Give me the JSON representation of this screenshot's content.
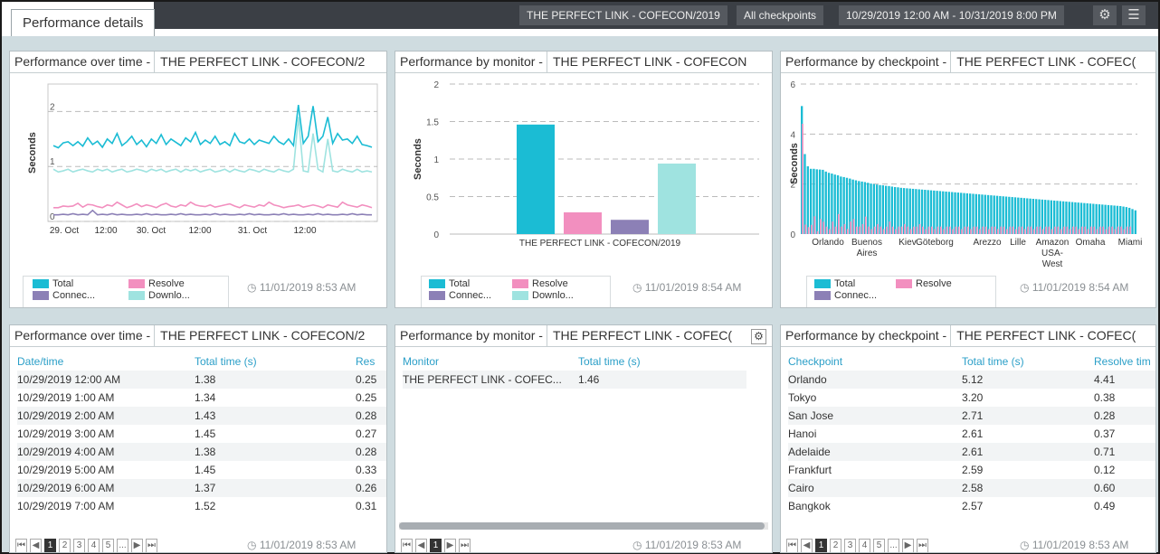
{
  "header": {
    "tab_label": "Performance details",
    "monitor": "THE PERFECT LINK - COFECON/2019",
    "checkpoints": "All checkpoints",
    "date_range": "10/29/2019 12:00 AM - 10/31/2019 8:00 PM",
    "gear_icon": "gear-icon",
    "menu_icon": "hamburger-menu-icon"
  },
  "colors": {
    "total": "#1bbcd4",
    "resolve": "#f28fbf",
    "connect": "#8c80b6",
    "download": "#9fe3e0"
  },
  "legend": {
    "total": "Total",
    "resolve": "Resolve",
    "connect": "Connec...",
    "download": "Downlo..."
  },
  "panels": {
    "p1": {
      "title": "Performance over time -",
      "selector": "THE PERFECT LINK - COFECON/2",
      "stamp": "11/01/2019 8:53 AM"
    },
    "p2": {
      "title": "Performance by monitor -",
      "selector": "THE PERFECT LINK - COFECON",
      "stamp": "11/01/2019 8:54 AM"
    },
    "p3": {
      "title": "Performance by checkpoint -",
      "selector": "THE PERFECT LINK - COFEC(",
      "stamp": "11/01/2019 8:54 AM"
    },
    "p4": {
      "title": "Performance over time -",
      "selector": "THE PERFECT LINK - COFECON/2",
      "stamp": "11/01/2019 8:53 AM"
    },
    "p5": {
      "title": "Performance by monitor -",
      "selector": "THE PERFECT LINK - COFEC(",
      "stamp": "11/01/2019 8:53 AM"
    },
    "p6": {
      "title": "Performance by checkpoint -",
      "selector": "THE PERFECT LINK - COFEC(",
      "stamp": "11/01/2019 8:53 AM"
    }
  },
  "chart_data": [
    {
      "type": "line",
      "ylabel": "Seconds",
      "ylim": [
        0,
        2.5
      ],
      "yticks": [
        "0",
        "1",
        "2"
      ],
      "xticks": [
        "29. Oct",
        "12:00",
        "30. Oct",
        "12:00",
        "31. Oct",
        "12:00"
      ],
      "series": [
        {
          "name": "Total",
          "values": [
            1.38,
            1.34,
            1.43,
            1.45,
            1.38,
            1.45,
            1.37,
            1.52,
            1.4,
            1.46,
            1.35,
            1.5,
            1.42,
            1.6,
            1.38,
            1.45,
            1.55,
            1.4,
            1.48,
            1.36,
            1.5,
            1.42,
            1.58,
            1.4,
            1.5,
            1.44,
            1.38,
            1.52,
            1.45,
            1.62,
            1.4,
            1.48,
            1.42,
            1.55,
            1.4,
            1.45,
            1.38,
            1.6,
            1.45,
            1.42,
            1.5,
            1.4,
            1.48,
            1.45,
            1.42,
            1.55,
            1.45,
            1.4,
            1.5,
            1.38,
            2.12,
            1.42,
            1.55,
            2.1,
            1.45,
            1.55,
            1.9,
            1.42,
            1.6,
            1.48,
            1.5,
            1.42,
            1.55,
            1.4,
            1.38,
            1.35
          ]
        },
        {
          "name": "Download",
          "values": [
            0.95,
            0.9,
            0.92,
            0.95,
            0.9,
            0.93,
            0.95,
            0.92,
            0.9,
            0.95,
            0.92,
            0.95,
            0.9,
            0.93,
            0.95,
            0.9,
            0.92,
            0.95,
            0.93,
            0.9,
            0.95,
            0.92,
            0.95,
            0.9,
            0.93,
            0.95,
            0.9,
            0.95,
            0.92,
            0.95,
            0.9,
            0.93,
            0.95,
            0.9,
            0.92,
            0.95,
            0.9,
            0.95,
            0.92,
            0.9,
            0.95,
            0.93,
            0.9,
            0.95,
            0.92,
            0.9,
            0.95,
            0.92,
            0.9,
            0.95,
            1.9,
            0.92,
            0.9,
            1.6,
            0.95,
            0.9,
            1.5,
            0.92,
            0.9,
            0.95,
            0.92,
            0.9,
            0.95,
            0.9,
            0.92,
            0.9
          ]
        },
        {
          "name": "Resolve",
          "values": [
            0.25,
            0.25,
            0.28,
            0.27,
            0.28,
            0.33,
            0.26,
            0.31,
            0.3,
            0.27,
            0.25,
            0.3,
            0.28,
            0.35,
            0.3,
            0.25,
            0.28,
            0.32,
            0.27,
            0.3,
            0.28,
            0.25,
            0.3,
            0.33,
            0.28,
            0.26,
            0.3,
            0.28,
            0.35,
            0.3,
            0.28,
            0.27,
            0.3,
            0.26,
            0.28,
            0.3,
            0.32,
            0.28,
            0.25,
            0.3,
            0.28,
            0.26,
            0.3,
            0.28,
            0.35,
            0.3,
            0.28,
            0.25,
            0.27,
            0.28,
            0.3,
            0.26,
            0.28,
            0.3,
            0.28,
            0.25,
            0.3,
            0.28,
            0.26,
            0.35,
            0.3,
            0.28,
            0.26,
            0.3,
            0.28,
            0.25
          ]
        },
        {
          "name": "Connect",
          "values": [
            0.12,
            0.12,
            0.13,
            0.12,
            0.14,
            0.12,
            0.13,
            0.12,
            0.2,
            0.12,
            0.13,
            0.12,
            0.14,
            0.12,
            0.13,
            0.12,
            0.12,
            0.13,
            0.12,
            0.14,
            0.12,
            0.13,
            0.12,
            0.12,
            0.13,
            0.12,
            0.14,
            0.12,
            0.13,
            0.12,
            0.12,
            0.13,
            0.12,
            0.14,
            0.12,
            0.13,
            0.12,
            0.12,
            0.13,
            0.12,
            0.14,
            0.12,
            0.13,
            0.12,
            0.12,
            0.13,
            0.12,
            0.14,
            0.12,
            0.13,
            0.12,
            0.12,
            0.13,
            0.12,
            0.14,
            0.12,
            0.13,
            0.12,
            0.12,
            0.13,
            0.12,
            0.14,
            0.12,
            0.13,
            0.12,
            0.12
          ]
        }
      ]
    },
    {
      "type": "bar",
      "ylabel": "Seconds",
      "ylim": [
        0,
        2
      ],
      "yticks": [
        "0",
        "0.5",
        "1",
        "1.5",
        "2"
      ],
      "categories": [
        "THE PERFECT LINK - COFECON/2019"
      ],
      "series": [
        {
          "name": "Total",
          "values": [
            1.46
          ]
        },
        {
          "name": "Resolve",
          "values": [
            0.29
          ]
        },
        {
          "name": "Connect",
          "values": [
            0.19
          ]
        },
        {
          "name": "Download",
          "values": [
            0.94
          ]
        }
      ]
    },
    {
      "type": "bar",
      "ylabel": "Seconds",
      "ylim": [
        0,
        6
      ],
      "yticks": [
        "0",
        "2",
        "4",
        "6"
      ],
      "xticks": [
        "Orlando",
        "Buenos Aires",
        "Kiev",
        "Göteborg",
        "Arezzo",
        "Lille",
        "Amazon USA-West",
        "Omaha",
        "Miami"
      ],
      "series": [
        {
          "name": "Total",
          "values": [
            5.12,
            3.2,
            2.71,
            2.61,
            2.61,
            2.59,
            2.58,
            2.57,
            2.5,
            2.45,
            2.42,
            2.38,
            2.35,
            2.3,
            2.28,
            2.25,
            2.22,
            2.18,
            2.15,
            2.12,
            2.1,
            2.08,
            2.05,
            2.02,
            2.0,
            1.98,
            1.96,
            1.95,
            1.93,
            1.92,
            1.9,
            1.88,
            1.87,
            1.85,
            1.84,
            1.83,
            1.82,
            1.81,
            1.8,
            1.79,
            1.78,
            1.77,
            1.76,
            1.75,
            1.74,
            1.73,
            1.72,
            1.71,
            1.7,
            1.69,
            1.68,
            1.67,
            1.66,
            1.65,
            1.64,
            1.63,
            1.62,
            1.61,
            1.6,
            1.59,
            1.58,
            1.57,
            1.56,
            1.55,
            1.54,
            1.53,
            1.52,
            1.51,
            1.5,
            1.49,
            1.48,
            1.47,
            1.46,
            1.45,
            1.44,
            1.43,
            1.42,
            1.41,
            1.4,
            1.39,
            1.38,
            1.37,
            1.36,
            1.35,
            1.34,
            1.33,
            1.32,
            1.31,
            1.3,
            1.29,
            1.28,
            1.27,
            1.26,
            1.25,
            1.24,
            1.23,
            1.22,
            1.21,
            1.2,
            1.19,
            1.18,
            1.17,
            1.16,
            1.15,
            1.14,
            1.13,
            1.12,
            1.1,
            1.08,
            1.05,
            1.0,
            0.95
          ]
        },
        {
          "name": "Resolve",
          "values": [
            4.41,
            0.38,
            0.28,
            0.37,
            0.71,
            0.12,
            0.6,
            0.49,
            0.3,
            0.2,
            0.5,
            0.3,
            0.8,
            0.3,
            0.4,
            0.2,
            0.5,
            0.6,
            0.3,
            0.3,
            0.4,
            0.7,
            0.3,
            0.2,
            0.3,
            0.4,
            0.3,
            0.2,
            0.3,
            0.5,
            0.3,
            0.2,
            0.3,
            0.3,
            0.4,
            0.3,
            0.2,
            0.3,
            0.3,
            0.4,
            0.3,
            0.2,
            0.3,
            0.3,
            0.2,
            0.3,
            0.3,
            0.2,
            0.3,
            0.3,
            0.2,
            0.3,
            0.3,
            0.2,
            0.3,
            0.3,
            0.2,
            0.3,
            0.3,
            0.2,
            0.3,
            0.3,
            0.2,
            0.3,
            0.3,
            0.2,
            0.3,
            0.3,
            0.2,
            0.3,
            0.3,
            0.2,
            0.3,
            0.3,
            0.2,
            0.3,
            0.3,
            0.2,
            0.3,
            0.3,
            0.2,
            0.3,
            0.3,
            0.2,
            0.3,
            0.3,
            0.2,
            0.3,
            0.3,
            0.2,
            0.3,
            0.3,
            0.2,
            0.3,
            0.3,
            0.2,
            0.3,
            0.3,
            0.2,
            0.3,
            0.3,
            0.2,
            0.3,
            0.3,
            0.2,
            0.3,
            0.3,
            0.2,
            0.3,
            0.3
          ]
        }
      ]
    }
  ],
  "table_time": {
    "headers": [
      "Date/time",
      "Total time (s)",
      "Res"
    ],
    "rows": [
      [
        "10/29/2019 12:00 AM",
        "1.38",
        "0.25"
      ],
      [
        "10/29/2019 1:00 AM",
        "1.34",
        "0.25"
      ],
      [
        "10/29/2019 2:00 AM",
        "1.43",
        "0.28"
      ],
      [
        "10/29/2019 3:00 AM",
        "1.45",
        "0.27"
      ],
      [
        "10/29/2019 4:00 AM",
        "1.38",
        "0.28"
      ],
      [
        "10/29/2019 5:00 AM",
        "1.45",
        "0.33"
      ],
      [
        "10/29/2019 6:00 AM",
        "1.37",
        "0.26"
      ],
      [
        "10/29/2019 7:00 AM",
        "1.52",
        "0.31"
      ]
    ],
    "pages": [
      "1",
      "2",
      "3",
      "4",
      "5",
      "..."
    ]
  },
  "table_monitor": {
    "headers": [
      "Monitor",
      "Total time (s)"
    ],
    "rows": [
      [
        "THE PERFECT LINK - COFEC...",
        "1.46"
      ]
    ],
    "pages": [
      "1"
    ]
  },
  "table_checkpoint": {
    "headers": [
      "Checkpoint",
      "Total time (s)",
      "Resolve tim"
    ],
    "rows": [
      [
        "Orlando",
        "5.12",
        "4.41"
      ],
      [
        "Tokyo",
        "3.20",
        "0.38"
      ],
      [
        "San Jose",
        "2.71",
        "0.28"
      ],
      [
        "Hanoi",
        "2.61",
        "0.37"
      ],
      [
        "Adelaide",
        "2.61",
        "0.71"
      ],
      [
        "Frankfurt",
        "2.59",
        "0.12"
      ],
      [
        "Cairo",
        "2.58",
        "0.60"
      ],
      [
        "Bangkok",
        "2.57",
        "0.49"
      ]
    ],
    "pages": [
      "1",
      "2",
      "3",
      "4",
      "5",
      "..."
    ]
  }
}
